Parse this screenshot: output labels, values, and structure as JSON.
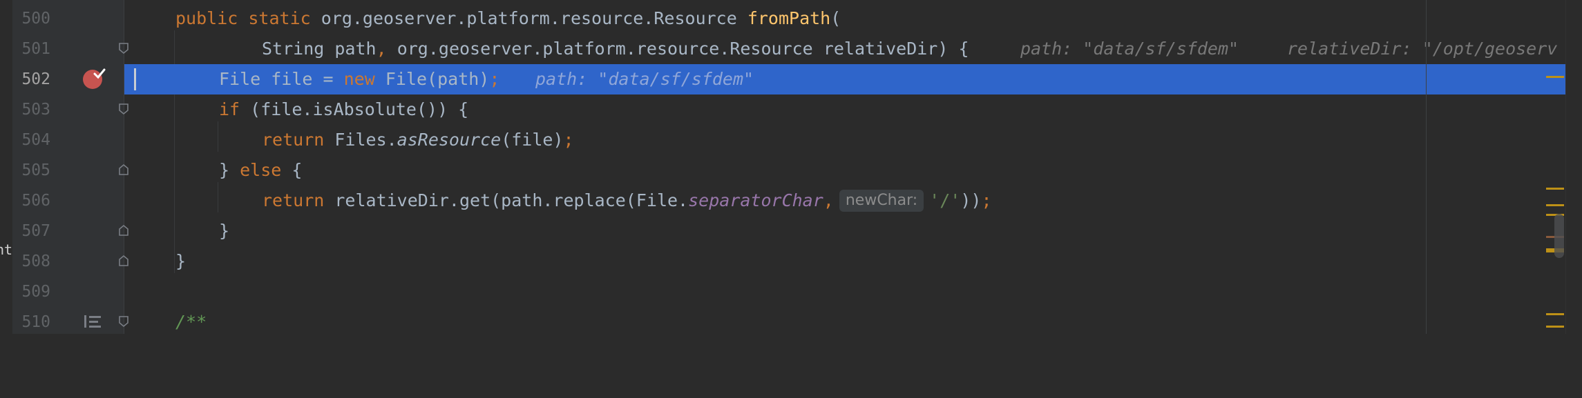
{
  "edge_fragment": "nt",
  "gutter": {
    "line_numbers": [
      "500",
      "501",
      "502",
      "503",
      "504",
      "505",
      "506",
      "507",
      "508",
      "509",
      "510"
    ],
    "current_line": "502"
  },
  "code": {
    "l500": {
      "p1": "public static ",
      "p2": "org.geoserver.platform.resource.Resource ",
      "p3": "fromPath",
      "p4": "("
    },
    "l501": {
      "p1": "String path",
      "p2": ", ",
      "p3": "org.geoserver.platform.resource.Resource relativeDir) {",
      "hint1": "path: \"data/sf/sfdem\"",
      "hint2": "relativeDir: \"/opt/geoserv"
    },
    "l502": {
      "p1": "File file = ",
      "p2": "new ",
      "p3": "File(path)",
      "p4": ";",
      "hint": "path: \"data/sf/sfdem\""
    },
    "l503": {
      "p1": "if ",
      "p2": "(file.isAbsolute()) {"
    },
    "l504": {
      "p1": "return ",
      "p2": "Files.",
      "p3": "asResource",
      "p4": "(file)",
      "p5": ";"
    },
    "l505": {
      "p1": "} ",
      "p2": "else ",
      "p3": "{"
    },
    "l506": {
      "p1": "return ",
      "p2": "relativeDir.get(path.replace(File.",
      "p3": "separatorChar",
      "p4": ",",
      "pill": "newChar:",
      "p5": "'/'",
      "p6": "))",
      "p7": ";"
    },
    "l507": {
      "p1": "}"
    },
    "l508": {
      "p1": "}"
    },
    "l509": {
      "p1": ""
    },
    "l510": {
      "p1": "/**"
    }
  },
  "colors": {
    "background": "#2b2b2b",
    "gutter": "#313335",
    "current_line_highlight": "#2f65ca",
    "keyword": "#cc7832",
    "method_declaration": "#ffc66d",
    "string": "#6a8759",
    "static_field": "#9876aa",
    "breakpoint": "#c75450",
    "warning_mark": "#be9117"
  },
  "icons": {
    "breakpoint": "breakpoint-verified-icon",
    "fold": "fold-toggle-icon",
    "doc": "render-doc-icon"
  }
}
